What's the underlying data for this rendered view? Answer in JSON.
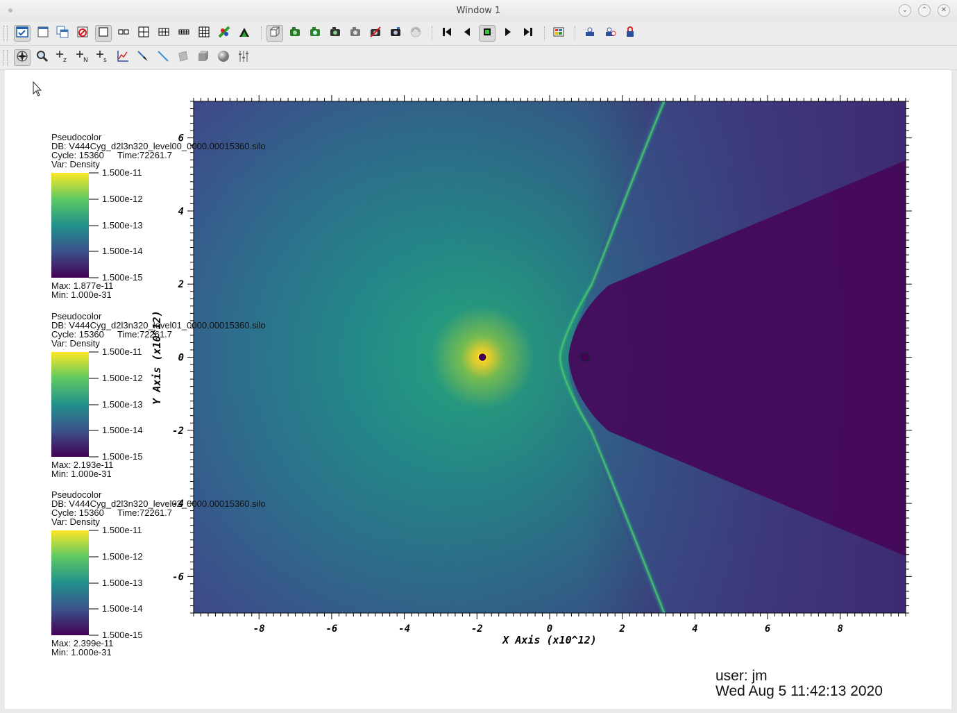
{
  "window": {
    "title": "Window 1"
  },
  "toolbar1_icons": [
    "toggle-mode-icon",
    "new-window-icon",
    "clone-window-icon",
    "delete-window-icon",
    "layout-1x1-icon",
    "layout-1x2-icon",
    "layout-2x2-icon",
    "layout-2x3-icon",
    "layout-2x4-icon",
    "layout-3x3-icon",
    "lock-view-icon",
    "lock-time-icon",
    "view-3d-icon",
    "save-image-icon",
    "camera-icon",
    "camera-icon",
    "camera-icon",
    "camera-off-icon",
    "camera-icon",
    "spin-icon",
    "skip-back-icon",
    "step-back-icon",
    "stop-icon",
    "play-icon",
    "skip-forward-icon",
    "color-table-icon",
    "clear-plots-icon",
    "reopen-icon",
    "lock-icon"
  ],
  "toolbar2_icons": [
    "navigate-icon",
    "zoom-icon",
    "zone-pick-icon",
    "node-pick-icon",
    "spreadsheet-pick-icon",
    "curve-query-icon",
    "point-tool-icon",
    "line-tool-icon",
    "plane-tool-icon",
    "box-tool-icon",
    "sphere-tool-icon",
    "axis-array-icon"
  ],
  "plot": {
    "x_axis_title": "X Axis (x10^12)",
    "y_axis_title": "Y Axis (x10^12)",
    "x_range": [
      -9.8,
      9.8
    ],
    "y_range": [
      -7.0,
      7.0
    ],
    "x_ticks": [
      -8,
      -6,
      -4,
      -2,
      0,
      2,
      4,
      6,
      8
    ],
    "y_ticks": [
      6,
      4,
      2,
      0,
      -2,
      -4,
      -6
    ],
    "stars": [
      {
        "name": "primary-star",
        "x": -1.85,
        "y": 0.0
      },
      {
        "name": "secondary-star",
        "x": 0.97,
        "y": 0.0
      }
    ]
  },
  "legends": [
    {
      "plot_type": "Pseudocolor",
      "db": "DB: V444Cyg_d2l3n320_level00_0000.00015360.silo",
      "cycle": "Cycle: 15360",
      "time": "Time:72261.7",
      "var": "Var: Density",
      "labels": [
        "1.500e-11",
        "1.500e-12",
        "1.500e-13",
        "1.500e-14",
        "1.500e-15"
      ],
      "max": "Max:  1.877e-11",
      "min": "Min:  1.000e-31"
    },
    {
      "plot_type": "Pseudocolor",
      "db": "DB: V444Cyg_d2l3n320_level01_0000.00015360.silo",
      "cycle": "Cycle: 15360",
      "time": "Time:72261.7",
      "var": "Var: Density",
      "labels": [
        "1.500e-11",
        "1.500e-12",
        "1.500e-13",
        "1.500e-14",
        "1.500e-15"
      ],
      "max": "Max:  2.193e-11",
      "min": "Min:  1.000e-31"
    },
    {
      "plot_type": "Pseudocolor",
      "db": "DB: V444Cyg_d2l3n320_level02_0000.00015360.silo",
      "cycle": "Cycle: 15360",
      "time": "Time:72261.7",
      "var": "Var: Density",
      "labels": [
        "1.500e-11",
        "1.500e-12",
        "1.500e-13",
        "1.500e-14",
        "1.500e-15"
      ],
      "max": "Max:  2.399e-11",
      "min": "Min:  1.000e-31"
    }
  ],
  "user_info": {
    "user": "user: jm",
    "date": "Wed Aug  5 11:42:13 2020"
  },
  "colors": {
    "viridis_top": "#fde725",
    "viridis_mid": "#21918c",
    "viridis_low": "#3b528b",
    "viridis_bottom": "#440154"
  }
}
